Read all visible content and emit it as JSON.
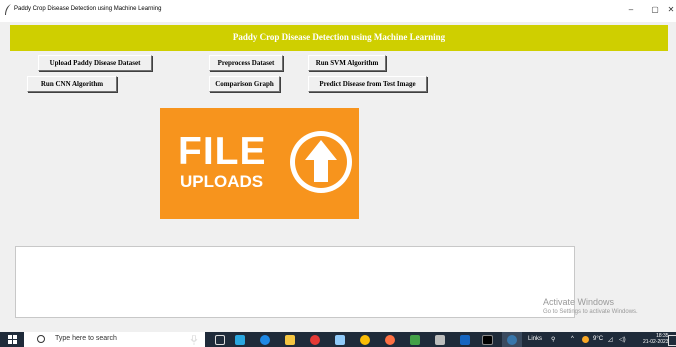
{
  "window": {
    "title": "Paddy Crop Disease Detection using Machine Learning",
    "controls": [
      "–",
      "▢",
      "✕"
    ]
  },
  "banner": {
    "text": "Paddy Crop Disease Detection using Machine Learning",
    "color": "#cfcf00"
  },
  "buttons": {
    "upload": "Upload Paddy Disease Dataset",
    "preprocess": "Preprocess Dataset",
    "svm": "Run SVM Algorithm",
    "cnn": "Run CNN Algorithm",
    "comparison": "Comparison Graph",
    "predict": "Predict Disease from Test Image"
  },
  "image": {
    "line1": "FILE",
    "line2": "UPLOADS",
    "color": "#f7941d"
  },
  "watermark": {
    "line1": "Activate Windows",
    "line2": "Go to Settings to activate Windows."
  },
  "taskbar": {
    "search_placeholder": "Type here to search",
    "links": "Links",
    "weather": "9°C",
    "time": "18:35",
    "date": "21-02-2023"
  }
}
